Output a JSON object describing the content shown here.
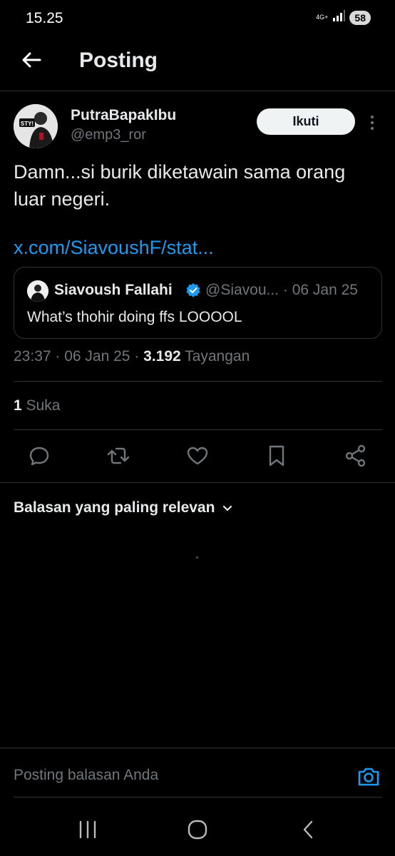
{
  "status_bar": {
    "time": "15.25",
    "network": "4G+",
    "battery": "58"
  },
  "header": {
    "title": "Posting"
  },
  "post": {
    "author_name": "PutraBapakIbu",
    "author_handle": "@emp3_ror",
    "avatar_text": "STY!",
    "follow_label": "Ikuti",
    "text": "Damn...si burik diketawain sama orang luar negeri.",
    "link": "x.com/SiavoushF/stat..."
  },
  "quote": {
    "author_name": "Siavoush Fallahi",
    "meta": "@Siavou... · 06 Jan 25",
    "text": "What’s thohir doing ffs LOOOOL"
  },
  "meta": {
    "time": "23:37",
    "sep1": " · ",
    "date": "06 Jan 25",
    "sep2": " · ",
    "views_count": "3.192",
    "views_label": " Tayangan"
  },
  "likes": {
    "count": "1",
    "label": " Suka"
  },
  "actions": [
    "reply-icon",
    "repost-icon",
    "like-icon",
    "bookmark-icon",
    "share-icon"
  ],
  "replies": {
    "sort_label": "Balasan yang paling relevan"
  },
  "reply_bar": {
    "placeholder": "Posting balasan Anda"
  },
  "colors": {
    "background": "#000000",
    "accent": "#1d9bf0",
    "text": "#e7e9ea",
    "muted": "#71767b",
    "border": "#2f3336"
  }
}
